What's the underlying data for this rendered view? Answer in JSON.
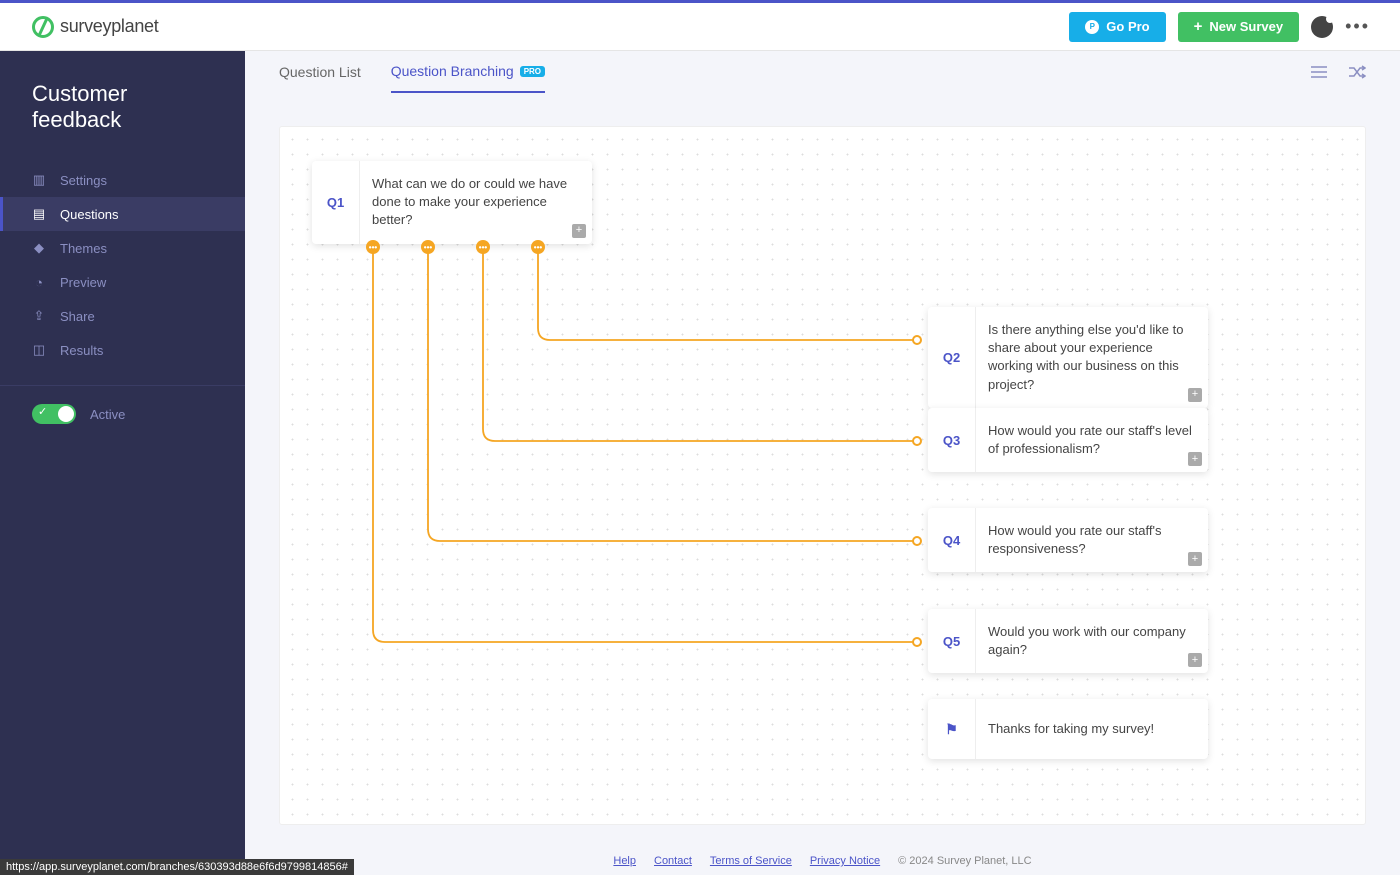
{
  "brand": {
    "name": "survey",
    "suffix": "planet"
  },
  "header": {
    "gopro_label": "Go Pro",
    "newsurvey_label": "New Survey"
  },
  "survey_title": "Customer feedback",
  "sidebar": {
    "items": [
      {
        "key": "settings",
        "label": "Settings",
        "icon": "▥"
      },
      {
        "key": "questions",
        "label": "Questions",
        "icon": "▤",
        "active": true
      },
      {
        "key": "themes",
        "label": "Themes",
        "icon": "◆"
      },
      {
        "key": "preview",
        "label": "Preview",
        "icon": "◔"
      },
      {
        "key": "share",
        "label": "Share",
        "icon": "⇪"
      },
      {
        "key": "results",
        "label": "Results",
        "icon": "◫"
      }
    ],
    "active_label": "Active"
  },
  "tabs": {
    "list_label": "Question List",
    "branching_label": "Question Branching",
    "pro_badge": "PRO"
  },
  "questions": {
    "q1": {
      "num": "Q1",
      "text": "What can we do or could we have done to make your experience better?"
    },
    "q2": {
      "num": "Q2",
      "text": "Is there anything else you'd like to share about your experience working with our business on this project?"
    },
    "q3": {
      "num": "Q3",
      "text": "How would you rate our staff's level of professionalism?"
    },
    "q4": {
      "num": "Q4",
      "text": "How would you rate our staff's responsiveness?"
    },
    "q5": {
      "num": "Q5",
      "text": "Would you work with our company again?"
    },
    "final": {
      "text": "Thanks for taking my survey!"
    }
  },
  "branch_connections": [
    {
      "from": "Q1",
      "to": "Q2"
    },
    {
      "from": "Q1",
      "to": "Q3"
    },
    {
      "from": "Q1",
      "to": "Q4"
    },
    {
      "from": "Q1",
      "to": "Q5"
    }
  ],
  "footer": {
    "help": "Help",
    "contact": "Contact",
    "terms": "Terms of Service",
    "privacy": "Privacy Notice",
    "copyright": "© 2024 Survey Planet, LLC"
  },
  "status_url": "https://app.surveyplanet.com/branches/630393d88e6f6d9799814856#"
}
